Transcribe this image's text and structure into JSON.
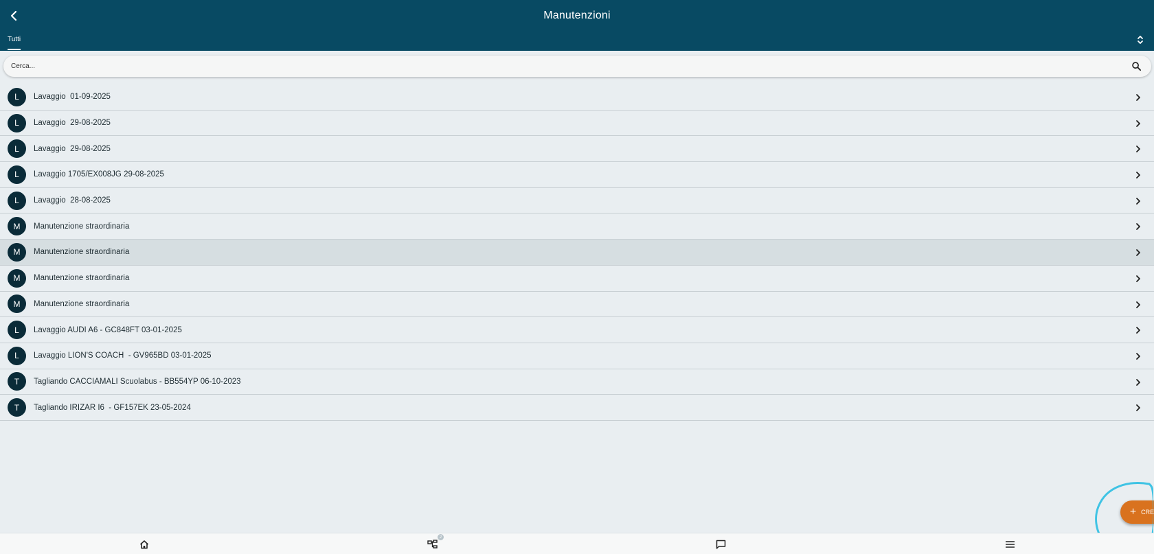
{
  "header": {
    "title": "Manutenzioni",
    "tab_label": "Tutti"
  },
  "search": {
    "placeholder": "Cerca..."
  },
  "list": {
    "items": [
      {
        "initial": "L",
        "label": "Lavaggio  01-09-2025"
      },
      {
        "initial": "L",
        "label": "Lavaggio  29-08-2025"
      },
      {
        "initial": "L",
        "label": "Lavaggio  29-08-2025"
      },
      {
        "initial": "L",
        "label": "Lavaggio 1705/EX008JG 29-08-2025"
      },
      {
        "initial": "L",
        "label": "Lavaggio  28-08-2025"
      },
      {
        "initial": "M",
        "label": "Manutenzione straordinaria"
      },
      {
        "initial": "M",
        "label": "Manutenzione straordinaria"
      },
      {
        "initial": "M",
        "label": "Manutenzione straordinaria"
      },
      {
        "initial": "M",
        "label": "Manutenzione straordinaria"
      },
      {
        "initial": "L",
        "label": "Lavaggio AUDI A6 - GC848FT 03-01-2025"
      },
      {
        "initial": "L",
        "label": "Lavaggio LION'S COACH  - GV965BD 03-01-2025"
      },
      {
        "initial": "T",
        "label": "Tagliando CACCIAMALI Scuolabus - BB554YP 06-10-2023"
      },
      {
        "initial": "T",
        "label": "Tagliando IRIZAR I6  - GF157EK 23-05-2024"
      }
    ]
  },
  "fab": {
    "plus": "+",
    "label": "CREA"
  },
  "bottom_nav": {
    "items": [
      {
        "icon": "home-icon"
      },
      {
        "icon": "org-chart-icon",
        "badge": "2"
      },
      {
        "icon": "chat-icon"
      },
      {
        "icon": "menu-icon"
      }
    ]
  },
  "colors": {
    "header_bg": "#084a63",
    "avatar_bg": "#0a2b38",
    "fab_bg": "#d9721e",
    "highlight": "#3fc3e4",
    "list_bg": "#e9eef1"
  }
}
